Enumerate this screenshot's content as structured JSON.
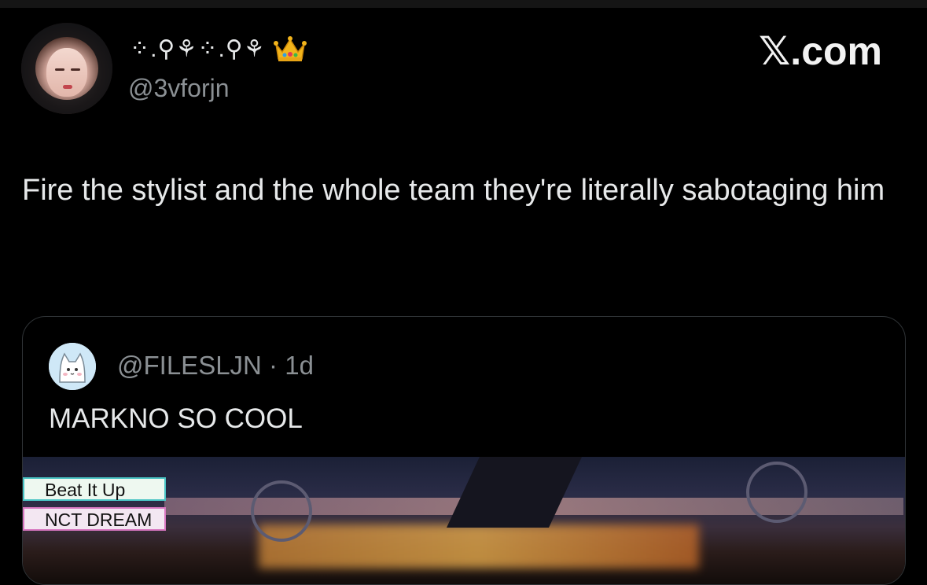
{
  "author": {
    "display_name": "⁘.⚲⚘⁘.⚲⚘",
    "handle": "@3vforjn",
    "avatar_icon": "avatar-photo",
    "badge_icon": "crown-icon"
  },
  "watermark": "𝕏.com",
  "tweet": {
    "text": "Fire the stylist and the whole team they're literally sabotaging him"
  },
  "quoted": {
    "handle_line": "@FILESLJN · 1d",
    "avatar_icon": "cat-avatar",
    "text": "MARKNO SO COOL",
    "media": {
      "overlay_song": "Beat It Up",
      "overlay_artist": "NCT DREAM"
    }
  }
}
